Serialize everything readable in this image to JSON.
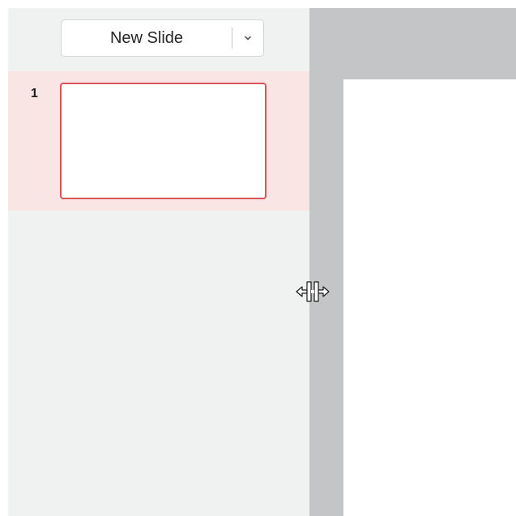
{
  "slide_panel": {
    "new_slide_label": "New Slide",
    "dropdown_icon": "chevron-down-icon",
    "slides": [
      {
        "number": "1",
        "selected": true
      }
    ]
  },
  "colors": {
    "panel_bg": "#f0f1f1",
    "selected_row_bg": "#fae5e5",
    "selected_border": "#d9535a",
    "editor_bg": "#c3c5c7"
  },
  "cursor": {
    "icon": "horizontal-resize-cursor-icon"
  }
}
